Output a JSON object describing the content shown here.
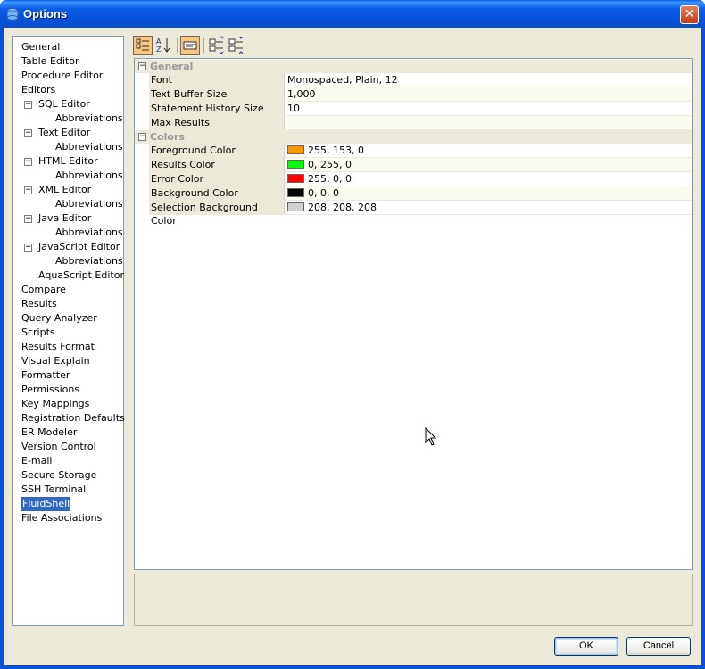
{
  "window": {
    "title": "Options",
    "close_label": "✕"
  },
  "tree": {
    "items": [
      {
        "label": "General",
        "level": 0,
        "expander": false
      },
      {
        "label": "Table Editor",
        "level": 0,
        "expander": false
      },
      {
        "label": "Procedure Editor",
        "level": 0,
        "expander": false
      },
      {
        "label": "Editors",
        "level": 0,
        "expander": false
      },
      {
        "label": "SQL Editor",
        "level": 1,
        "expander": true
      },
      {
        "label": "Abbreviations",
        "level": 2,
        "expander": false
      },
      {
        "label": "Text Editor",
        "level": 1,
        "expander": true
      },
      {
        "label": "Abbreviations",
        "level": 2,
        "expander": false
      },
      {
        "label": "HTML Editor",
        "level": 1,
        "expander": true
      },
      {
        "label": "Abbreviations",
        "level": 2,
        "expander": false
      },
      {
        "label": "XML Editor",
        "level": 1,
        "expander": true
      },
      {
        "label": "Abbreviations",
        "level": 2,
        "expander": false
      },
      {
        "label": "Java Editor",
        "level": 1,
        "expander": true
      },
      {
        "label": "Abbreviations",
        "level": 2,
        "expander": false
      },
      {
        "label": "JavaScript Editor",
        "level": 1,
        "expander": true
      },
      {
        "label": "Abbreviations",
        "level": 2,
        "expander": false
      },
      {
        "label": "AquaScript Editor",
        "level": 1,
        "expander": false
      },
      {
        "label": "Compare",
        "level": 0,
        "expander": false
      },
      {
        "label": "Results",
        "level": 0,
        "expander": false
      },
      {
        "label": "Query Analyzer",
        "level": 0,
        "expander": false
      },
      {
        "label": "Scripts",
        "level": 0,
        "expander": false
      },
      {
        "label": "Results Format",
        "level": 0,
        "expander": false
      },
      {
        "label": "Visual Explain",
        "level": 0,
        "expander": false
      },
      {
        "label": "Formatter",
        "level": 0,
        "expander": false
      },
      {
        "label": "Permissions",
        "level": 0,
        "expander": false
      },
      {
        "label": "Key Mappings",
        "level": 0,
        "expander": false
      },
      {
        "label": "Registration Defaults",
        "level": 0,
        "expander": false
      },
      {
        "label": "ER Modeler",
        "level": 0,
        "expander": false
      },
      {
        "label": "Version Control",
        "level": 0,
        "expander": false
      },
      {
        "label": "E-mail",
        "level": 0,
        "expander": false
      },
      {
        "label": "Secure Storage",
        "level": 0,
        "expander": false
      },
      {
        "label": "SSH Terminal",
        "level": 0,
        "expander": false
      },
      {
        "label": "FluidShell",
        "level": 0,
        "expander": false,
        "selected": true
      },
      {
        "label": "File Associations",
        "level": 0,
        "expander": false
      }
    ]
  },
  "toolbar": {
    "buttons": [
      {
        "name": "categorized-view-icon",
        "pressed": true
      },
      {
        "name": "sort-alphabetically-icon",
        "pressed": false
      },
      {
        "name": "show-description-icon",
        "pressed": true
      },
      {
        "name": "expand-all-icon",
        "pressed": false
      },
      {
        "name": "collapse-all-icon",
        "pressed": false
      }
    ]
  },
  "properties": {
    "categories": [
      {
        "label": "General",
        "rows": [
          {
            "name": "Font",
            "value": "Monospaced, Plain, 12"
          },
          {
            "name": "Text Buffer Size",
            "value": "1,000"
          },
          {
            "name": "Statement History Size",
            "value": "10"
          },
          {
            "name": "Max Results",
            "value": ""
          }
        ]
      },
      {
        "label": "Colors",
        "rows": [
          {
            "name": "Foreground Color",
            "value": "255, 153, 0",
            "swatch": "#ff9900"
          },
          {
            "name": "Results Color",
            "value": "0, 255, 0",
            "swatch": "#00ff00"
          },
          {
            "name": "Error Color",
            "value": "255, 0, 0",
            "swatch": "#ff0000"
          },
          {
            "name": "Background Color",
            "value": "0, 0, 0",
            "swatch": "#000000"
          },
          {
            "name": "Selection Background Color",
            "value": "208, 208, 208",
            "swatch": "#d0d0d0"
          }
        ]
      }
    ]
  },
  "buttons": {
    "ok": "OK",
    "cancel": "Cancel"
  }
}
